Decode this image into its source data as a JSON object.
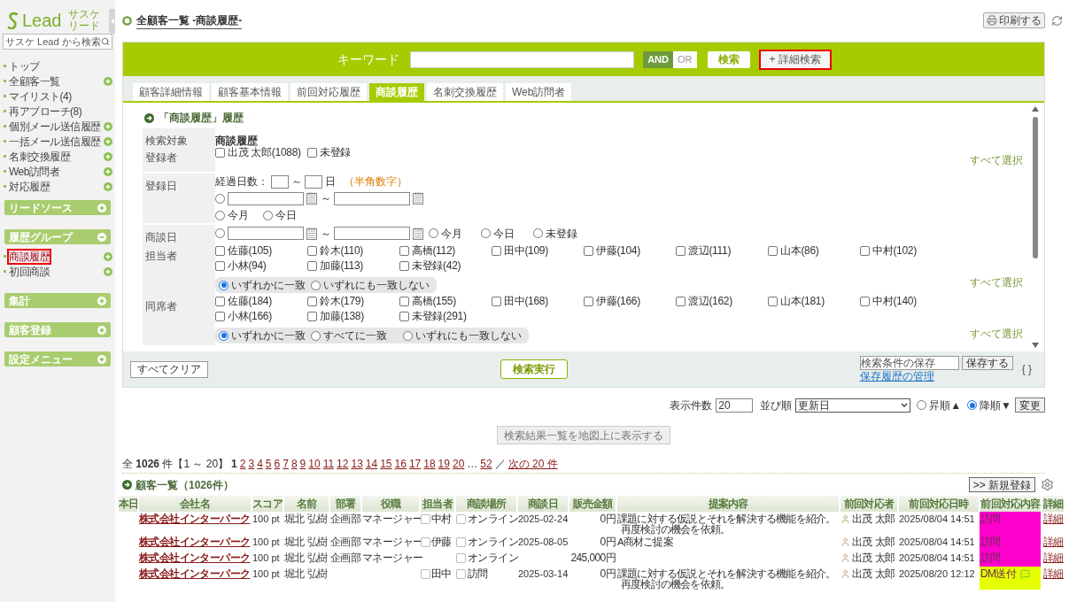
{
  "sidebar": {
    "logo": "Lead",
    "logo_sub": [
      "サスケ",
      "リード"
    ],
    "search_placeholder": "サスケ Lead から検索",
    "items": [
      {
        "label": "トップ",
        "addable": false,
        "selected": false
      },
      {
        "label": "全顧客一覧",
        "addable": true,
        "selected": false
      },
      {
        "label": "マイリスト(4)",
        "addable": false,
        "selected": false
      },
      {
        "label": "再アプローチ(8)",
        "addable": false,
        "selected": false
      },
      {
        "label": "個別メール送信履歴",
        "addable": true,
        "selected": false
      },
      {
        "label": "一括メール送信履歴",
        "addable": true,
        "selected": false
      },
      {
        "label": "名刺交換履歴",
        "addable": true,
        "selected": false
      },
      {
        "label": "Web訪問者",
        "addable": true,
        "selected": false
      },
      {
        "label": "対応履歴",
        "addable": true,
        "selected": false
      }
    ],
    "groups": [
      {
        "label": "リードソース",
        "expanded": false
      },
      {
        "label": "履歴グループ",
        "expanded": true,
        "items": [
          {
            "label": "商談履歴",
            "addable": true,
            "selected": true
          },
          {
            "label": "初回商談",
            "addable": true,
            "selected": false
          }
        ]
      },
      {
        "label": "集計",
        "expanded": false
      },
      {
        "label": "顧客登録",
        "expanded": false
      },
      {
        "label": "設定メニュー",
        "expanded": false
      }
    ]
  },
  "header": {
    "title": "全顧客一覧 -商談履歴-",
    "print_button": "印刷する"
  },
  "search": {
    "keyword_label": "キーワード",
    "modes": [
      {
        "label": "AND",
        "selected": true
      },
      {
        "label": "OR",
        "selected": false
      }
    ],
    "search_button": "検索",
    "detail_button": {
      "label": "+ 詳細検索",
      "highlighted": true
    }
  },
  "tabs": [
    {
      "label": "顧客詳細情報",
      "selected": false
    },
    {
      "label": "顧客基本情報",
      "selected": false
    },
    {
      "label": "前回対応履歴",
      "selected": false
    },
    {
      "label": "商談履歴",
      "selected": true
    },
    {
      "label": "名刺交換履歴",
      "selected": false
    },
    {
      "label": "Web訪問者",
      "selected": false
    }
  ],
  "section_title": "「商談履歴」履歴",
  "form_rows": [
    {
      "kind": "text",
      "label": "検索対象",
      "value": "商談履歴"
    },
    {
      "kind": "checks",
      "label": "登録者",
      "options": [
        {
          "label": "出茂 太郎(1088)",
          "checked": false
        },
        {
          "label": "未登録",
          "checked": false
        }
      ],
      "select_all": "すべて選択"
    },
    {
      "kind": "date_elapsed",
      "label": "登録日",
      "elapsed_label": "経過日数：",
      "separator": "～",
      "unit": "日",
      "hint": "（半角数字）",
      "range_selected": false,
      "range_separator": "～",
      "presets": [
        {
          "label": "今月",
          "selected": false
        },
        {
          "label": "今日",
          "selected": false
        }
      ]
    },
    {
      "kind": "date_inline",
      "label": "商談日",
      "range_selected": false,
      "range_separator": "～",
      "presets": [
        {
          "label": "今月",
          "selected": false
        },
        {
          "label": "今日",
          "selected": false
        },
        {
          "label": "未登録",
          "selected": false
        }
      ]
    },
    {
      "kind": "checks",
      "label": "担当者",
      "options": [
        {
          "label": "佐藤(105)",
          "checked": false
        },
        {
          "label": "鈴木(110)",
          "checked": false
        },
        {
          "label": "高橋(112)",
          "checked": false
        },
        {
          "label": "田中(109)",
          "checked": false
        },
        {
          "label": "伊藤(104)",
          "checked": false
        },
        {
          "label": "渡辺(111)",
          "checked": false
        },
        {
          "label": "山本(86)",
          "checked": false
        },
        {
          "label": "中村(102)",
          "checked": false
        },
        {
          "label": "小林(94)",
          "checked": false
        },
        {
          "label": "加藤(113)",
          "checked": false
        },
        {
          "label": "未登録(42)",
          "checked": false
        }
      ],
      "match": [
        {
          "label": "いずれかに一致",
          "selected": true
        },
        {
          "label": "いずれにも一致しない",
          "selected": false
        }
      ],
      "select_all": "すべて選択"
    },
    {
      "kind": "checks",
      "label": "同席者",
      "options": [
        {
          "label": "佐藤(184)",
          "checked": false
        },
        {
          "label": "鈴木(179)",
          "checked": false
        },
        {
          "label": "高橋(155)",
          "checked": false
        },
        {
          "label": "田中(168)",
          "checked": false
        },
        {
          "label": "伊藤(166)",
          "checked": false
        },
        {
          "label": "渡辺(162)",
          "checked": false
        },
        {
          "label": "山本(181)",
          "checked": false
        },
        {
          "label": "中村(140)",
          "checked": false
        },
        {
          "label": "小林(166)",
          "checked": false
        },
        {
          "label": "加藤(138)",
          "checked": false
        },
        {
          "label": "未登録(291)",
          "checked": false
        }
      ],
      "match": [
        {
          "label": "いずれかに一致",
          "selected": true
        },
        {
          "label": "すべてに一致",
          "selected": false
        },
        {
          "label": "いずれにも一致しない",
          "selected": false
        }
      ],
      "select_all": "すべて選択"
    }
  ],
  "footer": {
    "clear_button": "すべてクリア",
    "execute_button": "検索実行",
    "save_placeholder": "検索条件の保存",
    "save_button": "保存する",
    "history_link": "保存履歴の管理",
    "braces": "{ }"
  },
  "display": {
    "count_label": "表示件数",
    "count_value": "20",
    "sort_label": "並び順",
    "sort_value": "更新日",
    "orders": [
      {
        "label": "昇順▲",
        "selected": false
      },
      {
        "label": "降順▼",
        "selected": true
      }
    ],
    "apply_button": "変更"
  },
  "map_button": "検索結果一覧を地図上に表示する",
  "pagination": {
    "summary": "全 **1026** 件【1 ～ 20】",
    "pages": [
      {
        "label": "1",
        "selected": true
      },
      {
        "label": "2",
        "selected": false
      },
      {
        "label": "3",
        "selected": false
      },
      {
        "label": "4",
        "selected": false
      },
      {
        "label": "5",
        "selected": false
      },
      {
        "label": "6",
        "selected": false
      },
      {
        "label": "7",
        "selected": false
      },
      {
        "label": "8",
        "selected": false
      },
      {
        "label": "9",
        "selected": false
      },
      {
        "label": "10",
        "selected": false
      },
      {
        "label": "11",
        "selected": false
      },
      {
        "label": "12",
        "selected": false
      },
      {
        "label": "13",
        "selected": false
      },
      {
        "label": "14",
        "selected": false
      },
      {
        "label": "15",
        "selected": false
      },
      {
        "label": "16",
        "selected": false
      },
      {
        "label": "17",
        "selected": false
      },
      {
        "label": "18",
        "selected": false
      },
      {
        "label": "19",
        "selected": false
      },
      {
        "label": "20",
        "selected": false
      }
    ],
    "ellipsis": "…",
    "last": "52",
    "separator": "／",
    "next": "次の 20 件"
  },
  "list": {
    "title": "顧客一覧（1026件）",
    "new_button": ">> 新規登録"
  },
  "table": {
    "columns": [
      "本日",
      "会社名",
      "スコア",
      "名前",
      "部署",
      "役職",
      "担当者",
      "商談場所",
      "商談日",
      "販売金額",
      "提案内容",
      "前回対応者",
      "前回対応日時",
      "前回対応内容",
      "詳細"
    ],
    "rows": [
      {
        "company": "株式会社インターパーク",
        "score": "100 pt",
        "name": "堀北 弘樹",
        "department": "企画部",
        "title": "マネージャー",
        "rep": {
          "label": "中村",
          "checked": false
        },
        "place": {
          "label": "オンライン",
          "checked": false
        },
        "date": "2025-02-24",
        "amount": "0円",
        "proposal": [
          "課題に対する仮説とそれを解決する機能を紹介。",
          "再度検討の機会を依頼。"
        ],
        "responder": "出茂 太郎",
        "responded_at": "2025/08/04 14:51",
        "response": {
          "label": "訪問",
          "color": "#ff00cc",
          "comment": false
        },
        "detail": "詳細"
      },
      {
        "company": "株式会社インターパーク",
        "score": "100 pt",
        "name": "堀北 弘樹",
        "department": "企画部",
        "title": "マネージャー",
        "rep": {
          "label": "伊藤",
          "checked": false
        },
        "place": {
          "label": "オンライン",
          "checked": false
        },
        "date": "2025-08-05",
        "amount": "0円",
        "proposal": [
          "A商材ご提案"
        ],
        "responder": "出茂 太郎",
        "responded_at": "2025/08/04 14:51",
        "response": {
          "label": "訪問",
          "color": "#ff00cc",
          "comment": false
        },
        "detail": "詳細"
      },
      {
        "company": "株式会社インターパーク",
        "score": "100 pt",
        "name": "堀北 弘樹",
        "department": "企画部",
        "title": "マネージャー",
        "place": {
          "label": "オンライン",
          "checked": false
        },
        "amount": "245,000円",
        "responder": "出茂 太郎",
        "responded_at": "2025/08/04 14:51",
        "response": {
          "label": "訪問",
          "color": "#ff00cc",
          "comment": false
        },
        "detail": "詳細"
      },
      {
        "company": "株式会社インターパーク",
        "score": "100 pt",
        "name": "堀北 弘樹",
        "rep": {
          "label": "田中",
          "checked": false
        },
        "place": {
          "label": "訪問",
          "checked": false
        },
        "date": "2025-03-14",
        "amount": "0円",
        "proposal": [
          "課題に対する仮説とそれを解決する機能を紹介。",
          "再度検討の機会を依頼。"
        ],
        "responder": "出茂 太郎",
        "responded_at": "2025/08/20 12:12",
        "response": {
          "label": "DM送付",
          "color": "#e5ff00",
          "comment": true
        },
        "detail": "詳細"
      }
    ]
  }
}
